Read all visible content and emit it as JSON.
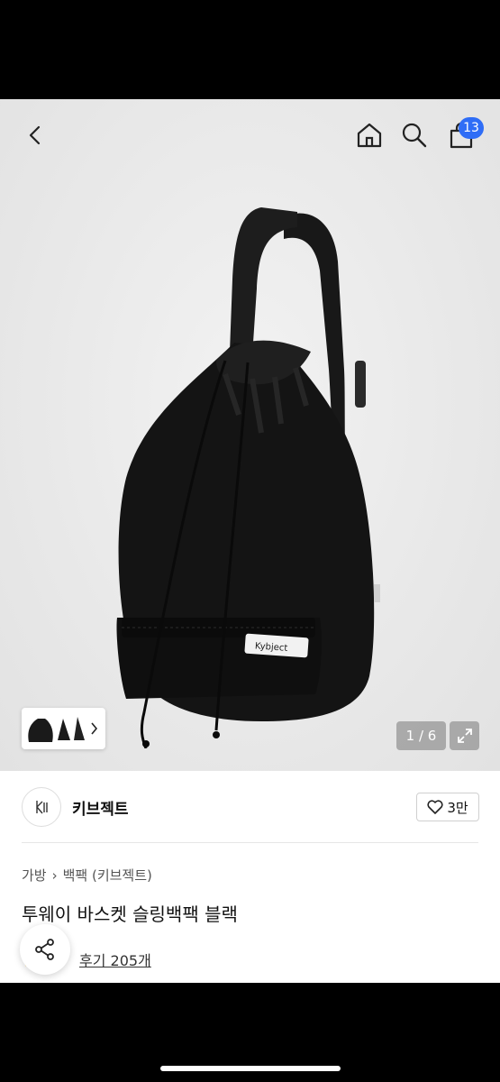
{
  "header": {
    "cart_count": "13"
  },
  "gallery": {
    "counter": "1 / 6",
    "label_tag": "Kybject"
  },
  "seller": {
    "name": "키브젝트",
    "likes": "3만"
  },
  "breadcrumb": {
    "level1": "가방",
    "separator": "›",
    "level2": "백팩 (키브젝트)"
  },
  "product": {
    "title": "투웨이 바스켓 슬링백팩 블랙"
  },
  "reviews": {
    "label": "후기 205개"
  },
  "icons": {
    "back": "chevron-left-icon",
    "home": "home-icon",
    "search": "search-icon",
    "cart": "shopping-bag-icon",
    "expand": "expand-icon",
    "heart": "heart-icon",
    "share": "share-icon",
    "star": "star-icon"
  },
  "colors": {
    "badge": "#2f6df6",
    "bag": "#141414",
    "star": "#f5b400"
  }
}
